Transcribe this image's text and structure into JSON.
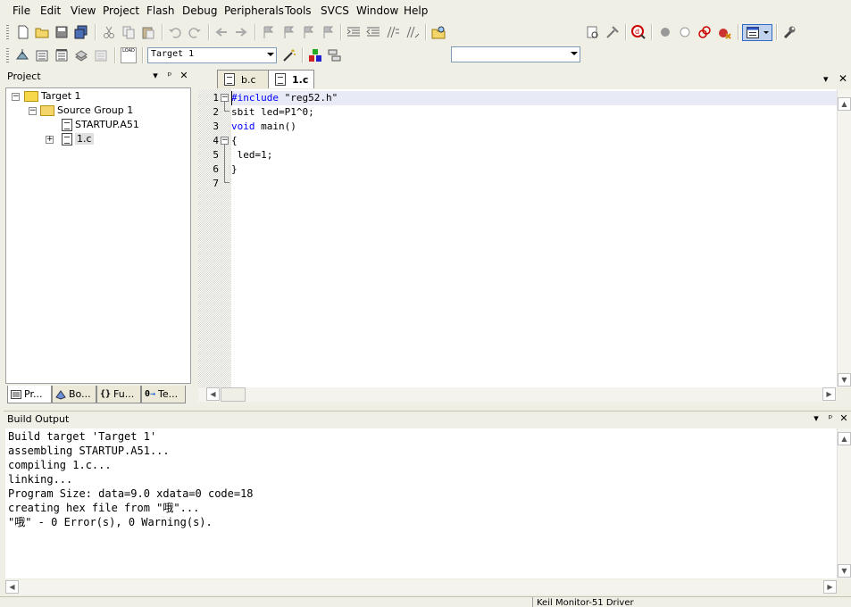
{
  "menu": [
    "File",
    "Edit",
    "View",
    "Project",
    "Flash",
    "Debug",
    "Peripherals",
    "Tools",
    "SVCS",
    "Window",
    "Help"
  ],
  "toolbar2": {
    "target_select": "Target 1",
    "load_label": "LOAD"
  },
  "project_panel": {
    "title": "Project",
    "tree": {
      "target": "Target 1",
      "group": "Source Group 1",
      "files": [
        "STARTUP.A51",
        "1.c"
      ]
    },
    "tabs": [
      "Pr...",
      "Bo...",
      "Fu...",
      "Te..."
    ]
  },
  "editor": {
    "tabs": [
      "b.c",
      "1.c"
    ],
    "active_tab": "1.c",
    "lines": [
      {
        "num": "1",
        "text": "#include \"reg52.h\""
      },
      {
        "num": "2",
        "text": "sbit led=P1^0;"
      },
      {
        "num": "3",
        "text": "void main()"
      },
      {
        "num": "4",
        "text": "{"
      },
      {
        "num": "5",
        "text": " led=1;"
      },
      {
        "num": "6",
        "text": "}"
      },
      {
        "num": "7",
        "text": ""
      }
    ]
  },
  "build_output": {
    "title": "Build Output",
    "lines": [
      "Build target 'Target 1'",
      "assembling STARTUP.A51...",
      "compiling 1.c...",
      "linking...",
      "Program Size: data=9.0 xdata=0 code=18",
      "creating hex file from \"哦\"...",
      "\"哦\" - 0 Error(s), 0 Warning(s)."
    ]
  },
  "status_bar": {
    "driver": "Keil Monitor-51 Driver"
  },
  "colors": {
    "current_line": "#e8eaf5",
    "keyword_blue": "#0000ff",
    "string_red": "#000000"
  }
}
